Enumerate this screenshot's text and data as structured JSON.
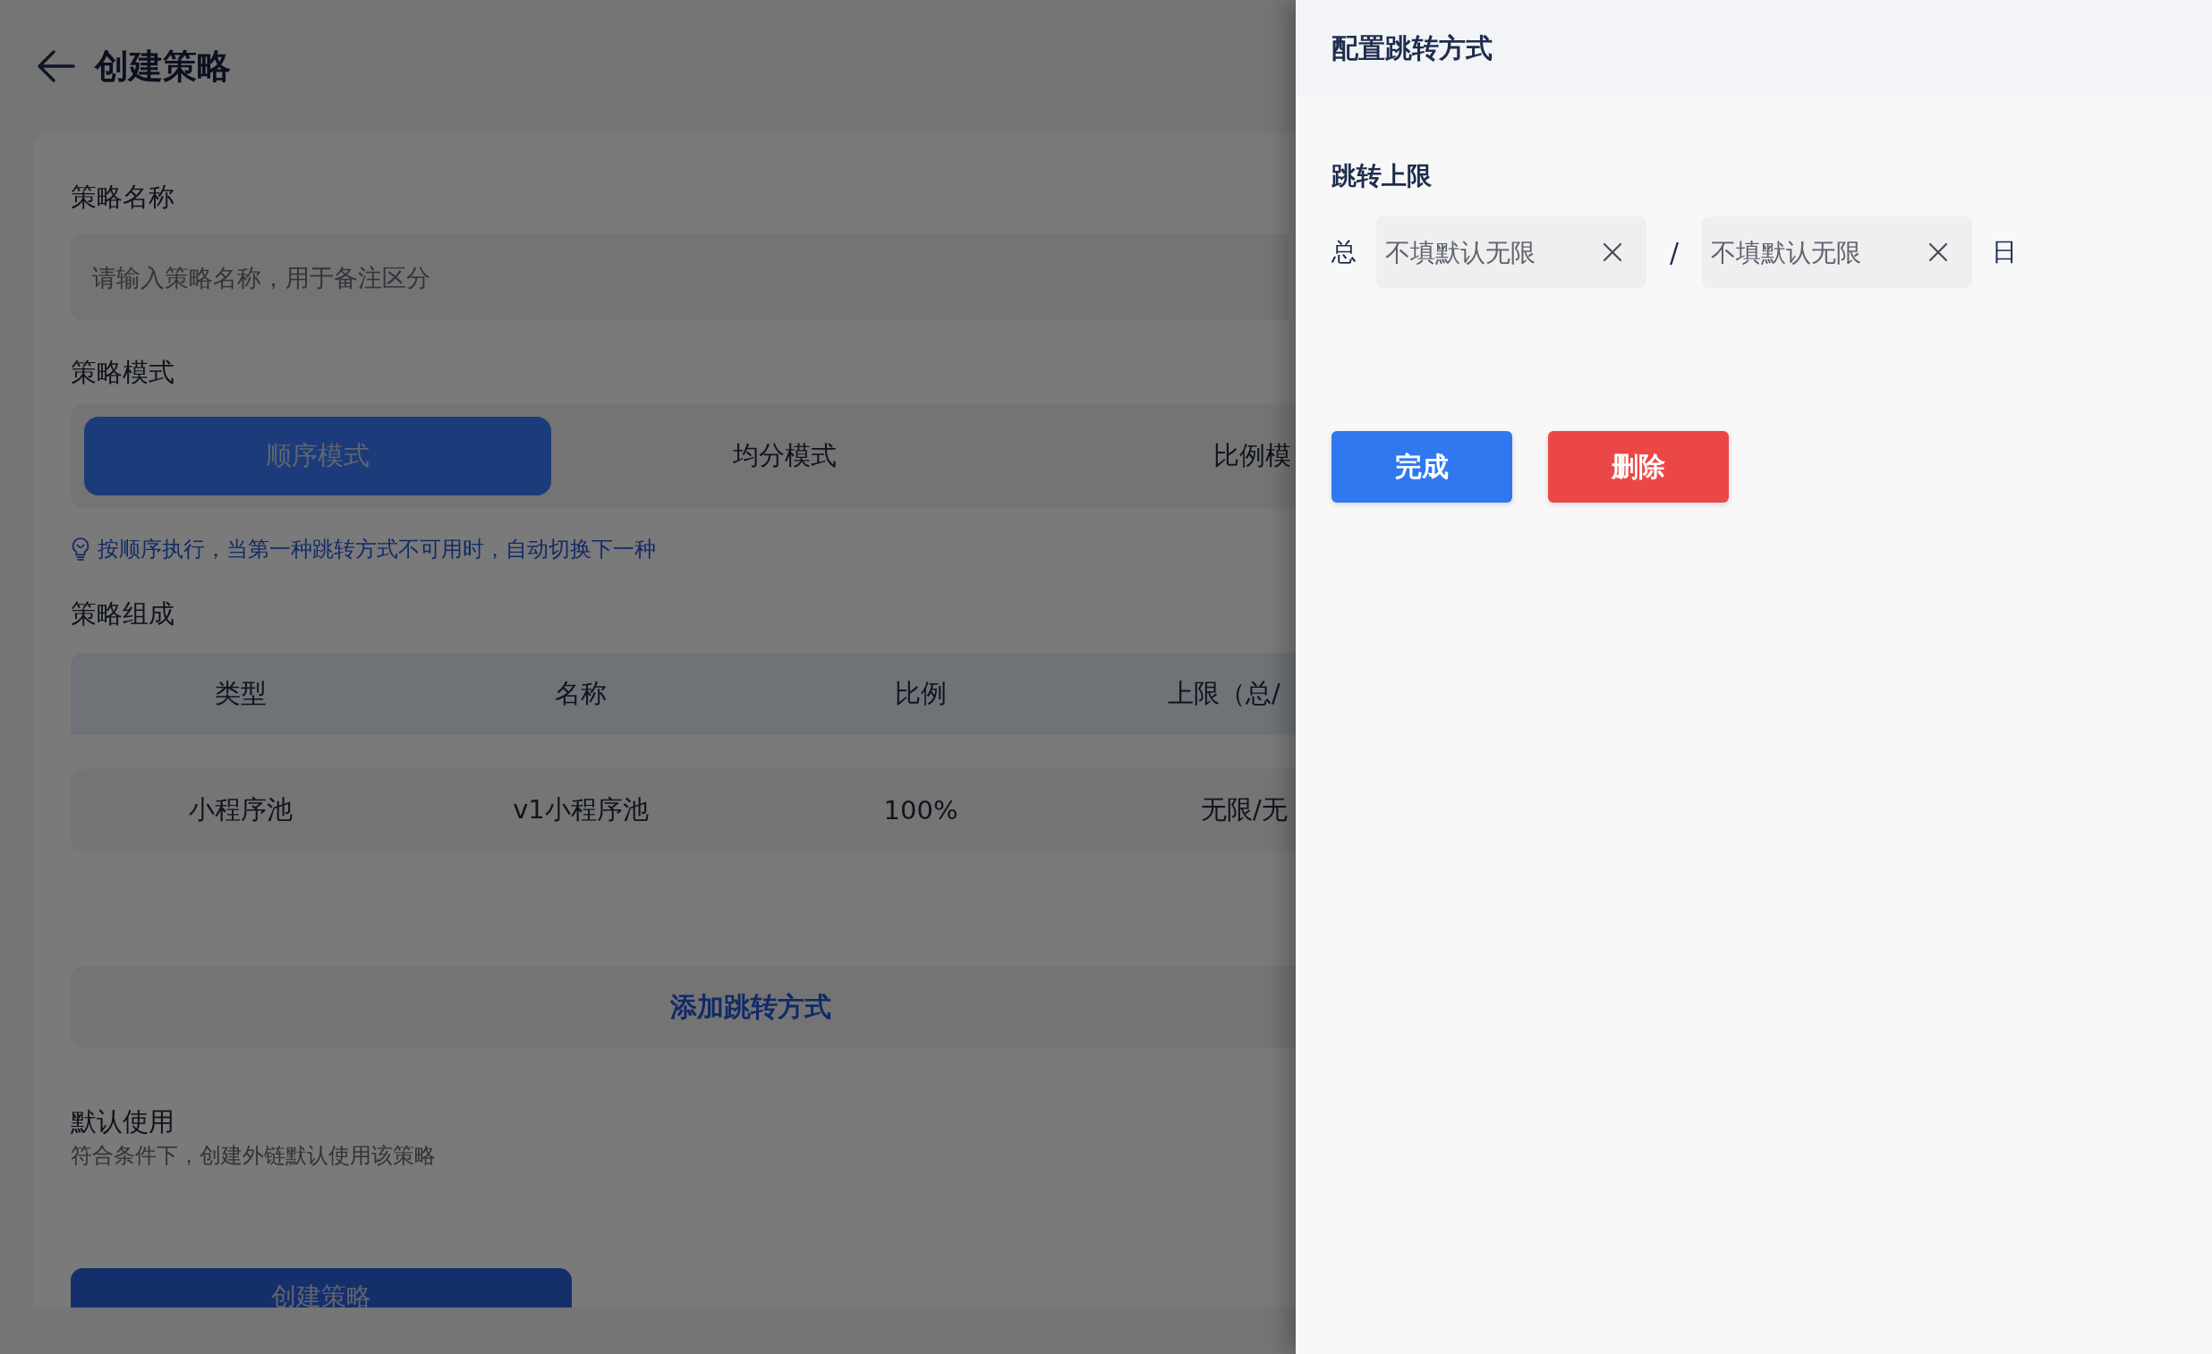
{
  "page": {
    "title": "创建策略",
    "name_field": {
      "label": "策略名称",
      "placeholder": "请输入策略名称，用于备注区分"
    },
    "mode": {
      "label": "策略模式",
      "options": [
        {
          "label": "顺序模式",
          "selected": true
        },
        {
          "label": "均分模式",
          "selected": false
        },
        {
          "label": "比例模",
          "selected": false
        }
      ],
      "hint": "按顺序执行，当第一种跳转方式不可用时，自动切换下一种"
    },
    "composition": {
      "label": "策略组成",
      "columns": [
        "类型",
        "名称",
        "比例",
        "上限（总/"
      ],
      "rows": [
        [
          "小程序池",
          "v1小程序池",
          "100%",
          "无限/无"
        ]
      ],
      "add_button": "添加跳转方式"
    },
    "default_use": {
      "label": "默认使用",
      "description": "符合条件下，创建外链默认使用该策略"
    },
    "submit_button": "创建策略"
  },
  "drawer": {
    "title": "配置跳转方式",
    "section": "跳转上限",
    "total_label": "总",
    "separator": "/",
    "day_label": "日",
    "fields": [
      {
        "placeholder": "不填默认无限"
      },
      {
        "placeholder": "不填默认无限"
      }
    ],
    "buttons": [
      {
        "label": "完成",
        "kind": "primary"
      },
      {
        "label": "删除",
        "kind": "danger"
      }
    ]
  }
}
